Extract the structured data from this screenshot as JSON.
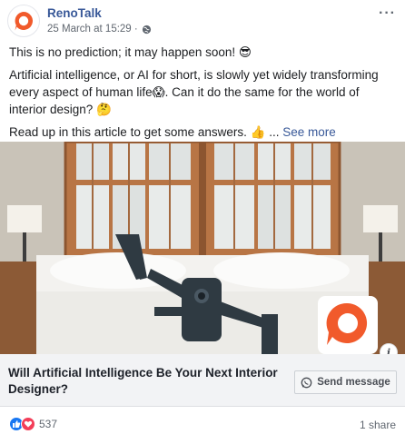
{
  "post": {
    "page_name": "RenoTalk",
    "timestamp": "25 March at 15:29 ·",
    "privacy_icon": "globe-icon",
    "more_label": "···",
    "text_line1": "This is no prediction; it may happen soon! 😎",
    "text_para2": "Artificial intelligence, or AI for short, is slowly yet widely transforming every aspect of human life😱. Can it do the same for the world of interior design? 🤔",
    "text_para3_prefix": "Read up in this article to get some answers. 👍 ... ",
    "see_more": "See more"
  },
  "link_preview": {
    "title": "Will Artificial Intelligence Be Your Next Interior Designer?",
    "send_button_label": "Send message",
    "info_icon": "info-icon",
    "brand_color": "#f15a2b"
  },
  "footer": {
    "reaction_count": "537",
    "shares": "1 share",
    "reaction_icons": [
      "like-icon",
      "love-icon"
    ]
  }
}
